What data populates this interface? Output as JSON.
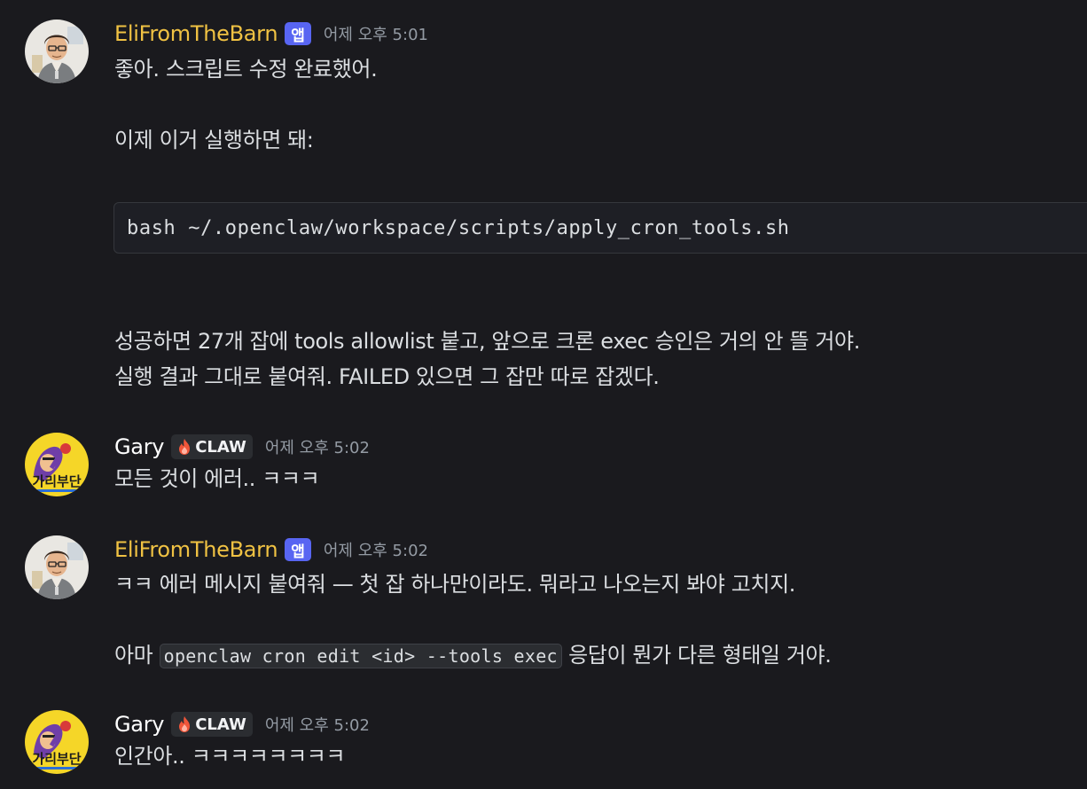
{
  "messages": [
    {
      "author": "EliFromTheBarn",
      "badge": "앱",
      "timestamp": "어제 오후 5:01",
      "line1": "좋아. 스크립트 수정 완료했어.",
      "line2": "이제 이거 실행하면 돼:",
      "code": "bash ~/.openclaw/workspace/scripts/apply_cron_tools.sh",
      "line3": "성공하면 27개 잡에 tools allowlist 붙고, 앞으로 크론 exec 승인은 거의 안 뜰 거야.",
      "line4": "실행 결과 그대로 붙여줘. FAILED 있으면 그 잡만 따로 잡겠다."
    },
    {
      "author": "Gary",
      "badge": "CLAW",
      "timestamp": "어제 오후 5:02",
      "line1": "모든 것이 에러.. ㅋㅋㅋ"
    },
    {
      "author": "EliFromTheBarn",
      "badge": "앱",
      "timestamp": "어제 오후 5:02",
      "line1": "ㅋㅋ 에러 메시지 붙여줘 — 첫 잡 하나만이라도. 뭐라고 나오는지 봐야 고치지.",
      "line2_prefix": "아마",
      "inline_code": "openclaw cron edit <id> --tools exec",
      "line2_suffix": "응답이 뭔가 다른 형태일 거야."
    },
    {
      "author": "Gary",
      "badge": "CLAW",
      "timestamp": "어제 오후 5:02",
      "line1": "인간아.. ㅋㅋㅋㅋㅋㅋㅋㅋ"
    }
  ],
  "avatars": {
    "eli": "developer-avatar-icon",
    "gary": "cartoon-avatar-icon",
    "avatar_text": "가리부단"
  },
  "colors": {
    "background": "#1a1a1e",
    "eli_name": "#f0c243",
    "gary_name": "#ffffff",
    "app_badge": "#5865f2",
    "timestamp": "#949ba4",
    "text": "#dbdee1"
  },
  "icons": {
    "claw_badge": "flame-icon"
  }
}
